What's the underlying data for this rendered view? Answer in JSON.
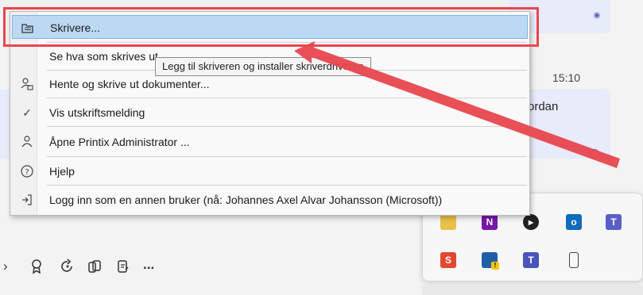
{
  "menu": {
    "items": [
      {
        "label": "Skrivere...",
        "icon": "printer-folder-icon",
        "highlighted": true
      },
      {
        "label": "Se hva som skrives ut",
        "icon": "",
        "highlighted": false
      },
      {
        "label": "Hente og skrive ut dokumenter...",
        "icon": "user-print-icon",
        "highlighted": false
      },
      {
        "label": "Vis utskriftsmelding",
        "icon": "checkmark-icon",
        "highlighted": false
      },
      {
        "label": "Åpne Printix Administrator ...",
        "icon": "admin-user-icon",
        "highlighted": false
      },
      {
        "label": "Hjelp",
        "icon": "help-icon",
        "highlighted": false
      },
      {
        "label": "Logg inn som en annen bruker (nå: Johannes Axel Alvar Johansson (Microsoft))",
        "icon": "sign-in-icon",
        "highlighted": false
      }
    ]
  },
  "tooltip": {
    "text": "Legg til skriveren og installer skriverdriveren"
  },
  "chat": {
    "timestamp": "15:10",
    "message_fragment": "ordan"
  },
  "toolbar": {
    "more_label": "..."
  },
  "tray": {
    "icons": [
      "network-icon",
      "onenote-icon",
      "media-player-icon",
      "outlook-icon",
      "teams-icon",
      "snagit-icon",
      "defender-warning-icon",
      "teams-personal-icon",
      "usb-drive-icon"
    ]
  },
  "colors": {
    "highlight_border": "#e8464e",
    "selection_bg": "#bcd9f4",
    "arrow": "#e8464e"
  }
}
